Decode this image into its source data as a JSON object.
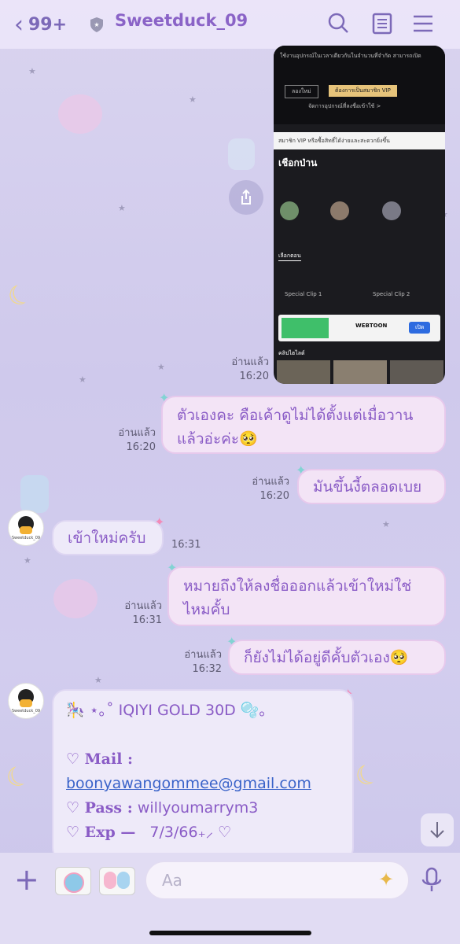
{
  "header": {
    "back_count": "99+",
    "contact_name": "Sweetduck_09"
  },
  "messages": [
    {
      "type": "image",
      "side": "out",
      "status": "อ่านแล้ว",
      "time": "16:20",
      "screen_texts": [
        "ใช้งานอุปกรณ์ในเวลาเดียวกันในจำนวนที่จำกัด สามารถเปิด",
        "ลองใหม่",
        "ต้องการเป็นสมาชิก VIP",
        "จัดการอุปกรณ์ที่ลงชื่อเข้าใช้ >",
        "สมาชิก VIP หรือซื้อสิทธิ์ได้ง่ายและสะดวกยิ่งขึ้น",
        "เชือกป่าน",
        "Special Clip 1",
        "Special Clip 2",
        "WEBTOON",
        "คลิปไฮไลต์",
        "เลือกตอน",
        "เปิด"
      ]
    },
    {
      "type": "text",
      "side": "out",
      "status": "อ่านแล้ว",
      "time": "16:20",
      "text": "ตัวเองคะ คือเค้าดูไม่ได้ตั้งแต่เมื่อวานแล้วอ่ะค่ะ🥺"
    },
    {
      "type": "text",
      "side": "out",
      "status": "อ่านแล้ว",
      "time": "16:20",
      "text": "มันขึ้นงี้ตลอดเบย"
    },
    {
      "type": "text",
      "side": "in",
      "time": "16:31",
      "text": "เข้าใหม่ครับ"
    },
    {
      "type": "text",
      "side": "out",
      "status": "อ่านแล้ว",
      "time": "16:31",
      "text": "หมายถึงให้ลงชื่อออกแล้วเข้าใหม่ใช่ไหมคั้บ"
    },
    {
      "type": "text",
      "side": "out",
      "status": "อ่านแล้ว",
      "time": "16:32",
      "text": "ก็ยังไม่ได้อยู่ดีคั้บตัวเอง🥺"
    }
  ],
  "card": {
    "title": "🎠 ⋆｡˚ IQIYI GOLD 30D 🫧｡",
    "mail_label": "♡ Mail :",
    "mail_value": "boonyawangommee@gmail.com",
    "pass_label": "♡ Pass :",
    "pass_value": "willyoumarrym3",
    "exp_label": "♡ Exp —",
    "exp_value": "7/3/66₊⸝ ♡"
  },
  "avatar_label": "Sweetduck_09",
  "composer": {
    "placeholder": "Aa"
  },
  "colors": {
    "accent": "#8a63c7",
    "bubble_out": "#f3e4f6",
    "bubble_in": "#eeeaf9",
    "link": "#3a63c9"
  }
}
